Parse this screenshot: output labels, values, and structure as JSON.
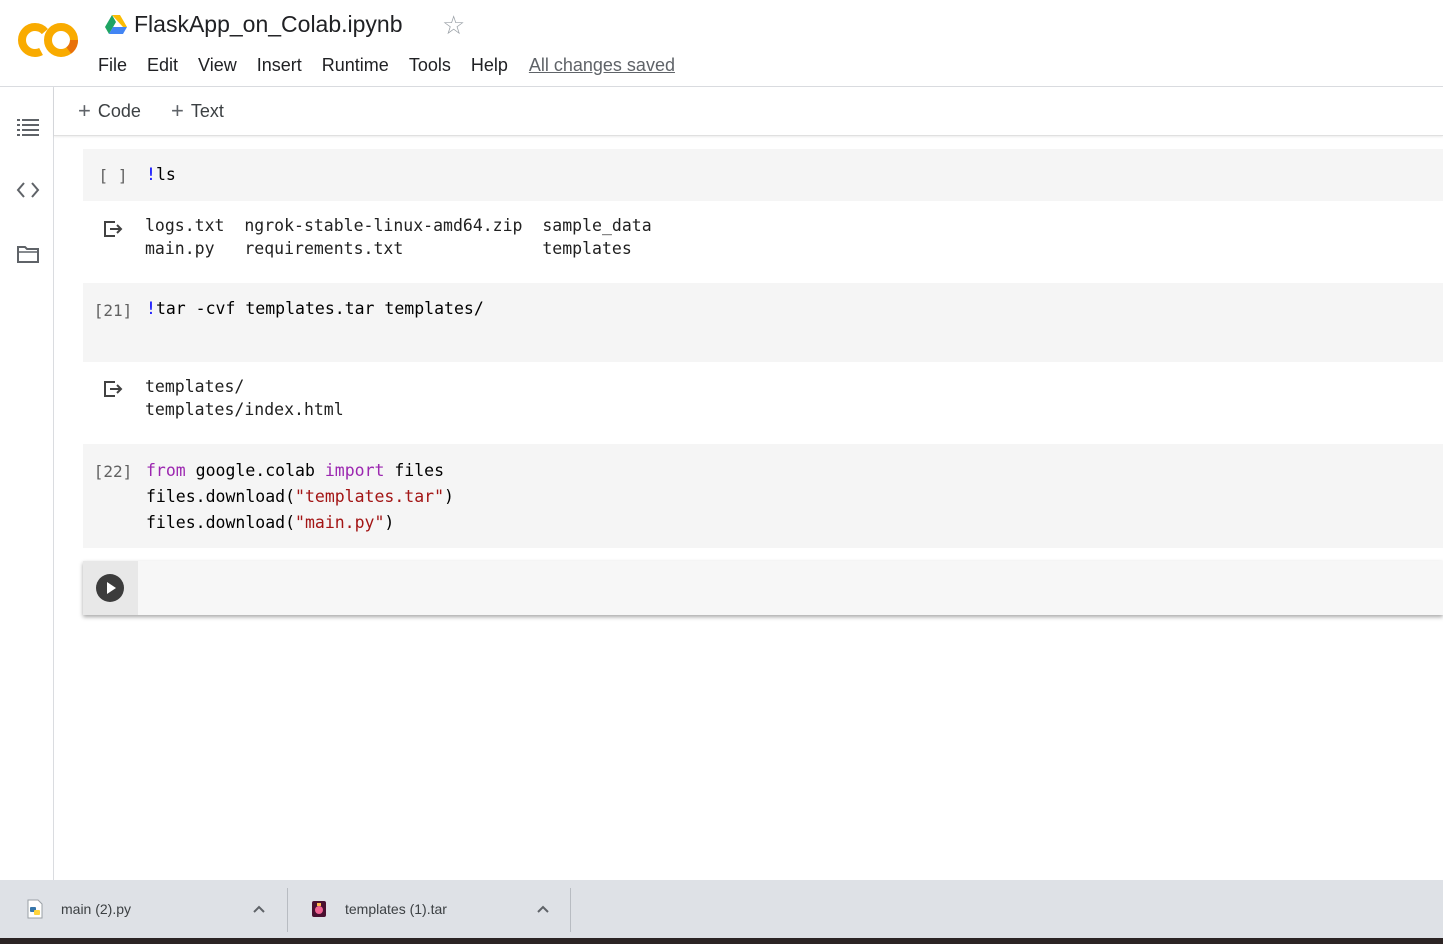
{
  "header": {
    "title": "FlaskApp_on_Colab.ipynb",
    "logo_icon": "colab-logo",
    "drive_icon": "google-drive-icon",
    "star_icon": "star-outline-icon",
    "star_glyph": "☆",
    "menu": [
      "File",
      "Edit",
      "View",
      "Insert",
      "Runtime",
      "Tools",
      "Help"
    ],
    "saved_status": "All changes saved"
  },
  "rail": {
    "items": [
      "table-of-contents-icon",
      "code-snippets-icon",
      "files-folder-icon"
    ]
  },
  "toolbar": {
    "add_code_label": "Code",
    "add_text_label": "Text",
    "plus_glyph": "+"
  },
  "cells": [
    {
      "exec_count": "[ ]",
      "code_lines": [
        "!ls"
      ],
      "output_lines": [
        "logs.txt  ngrok-stable-linux-amd64.zip  sample_data",
        "main.py   requirements.txt              templates"
      ]
    },
    {
      "exec_count": "[21]",
      "code_lines": [
        "!tar -cvf templates.tar templates/"
      ],
      "output_lines": [
        "templates/",
        "templates/index.html"
      ]
    },
    {
      "exec_count": "[22]",
      "code_lines": [
        "from google.colab import files",
        "files.download(\"templates.tar\")",
        "files.download(\"main.py\")"
      ]
    }
  ],
  "new_cell": {
    "run_icon": "run-cell-icon"
  },
  "downloads": [
    {
      "name": "main (2).py",
      "icon": "python-file-icon"
    },
    {
      "name": "templates (1).tar",
      "icon": "tar-archive-icon"
    }
  ],
  "colors": {
    "colab_orange": "#f9ab00",
    "colab_orange_dark": "#e8710a",
    "keyword": "#aa22ff",
    "string": "#a31515",
    "shell_bang": "#0000ff",
    "shelf_bg": "#dee1e6"
  }
}
